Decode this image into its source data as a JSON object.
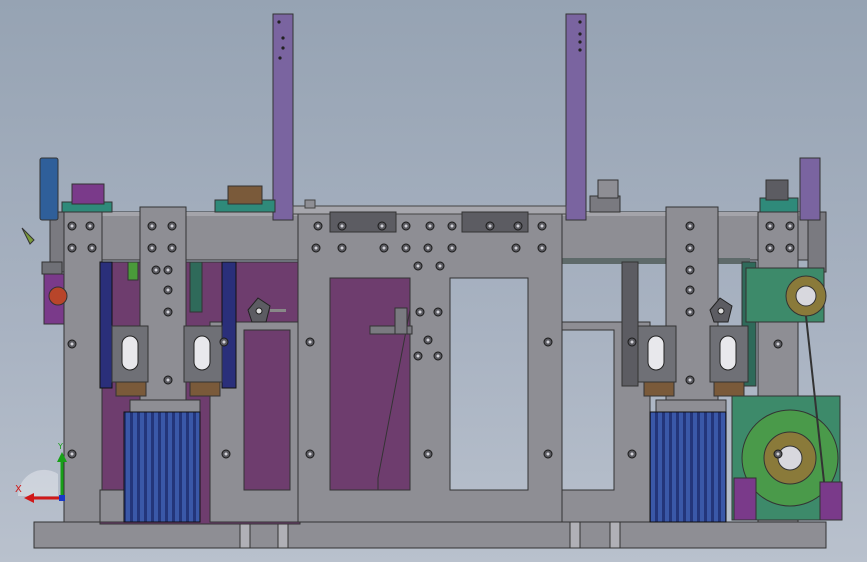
{
  "viewport": {
    "background_top": "#96a3b3",
    "background_bottom": "#b9c1cd"
  },
  "colors": {
    "steel": "#8e8e94",
    "steel_dark": "#6f7076",
    "purple": "#6e3d6e",
    "violet_post": "#7a64a0",
    "blue_motor": "#3a58a8",
    "navy_rail": "#2a2f7a",
    "green_reel": "#3d8a6a",
    "teal_block": "#2f8a7a",
    "brown_block": "#7a5a3a",
    "red_motor": "#b8452a",
    "handle_blue": "#2f5f9a"
  },
  "triad": {
    "x_label": "X",
    "y_label": "Y",
    "x_color": "#d01818",
    "y_color": "#18a018",
    "z_color": "#1838c8"
  }
}
